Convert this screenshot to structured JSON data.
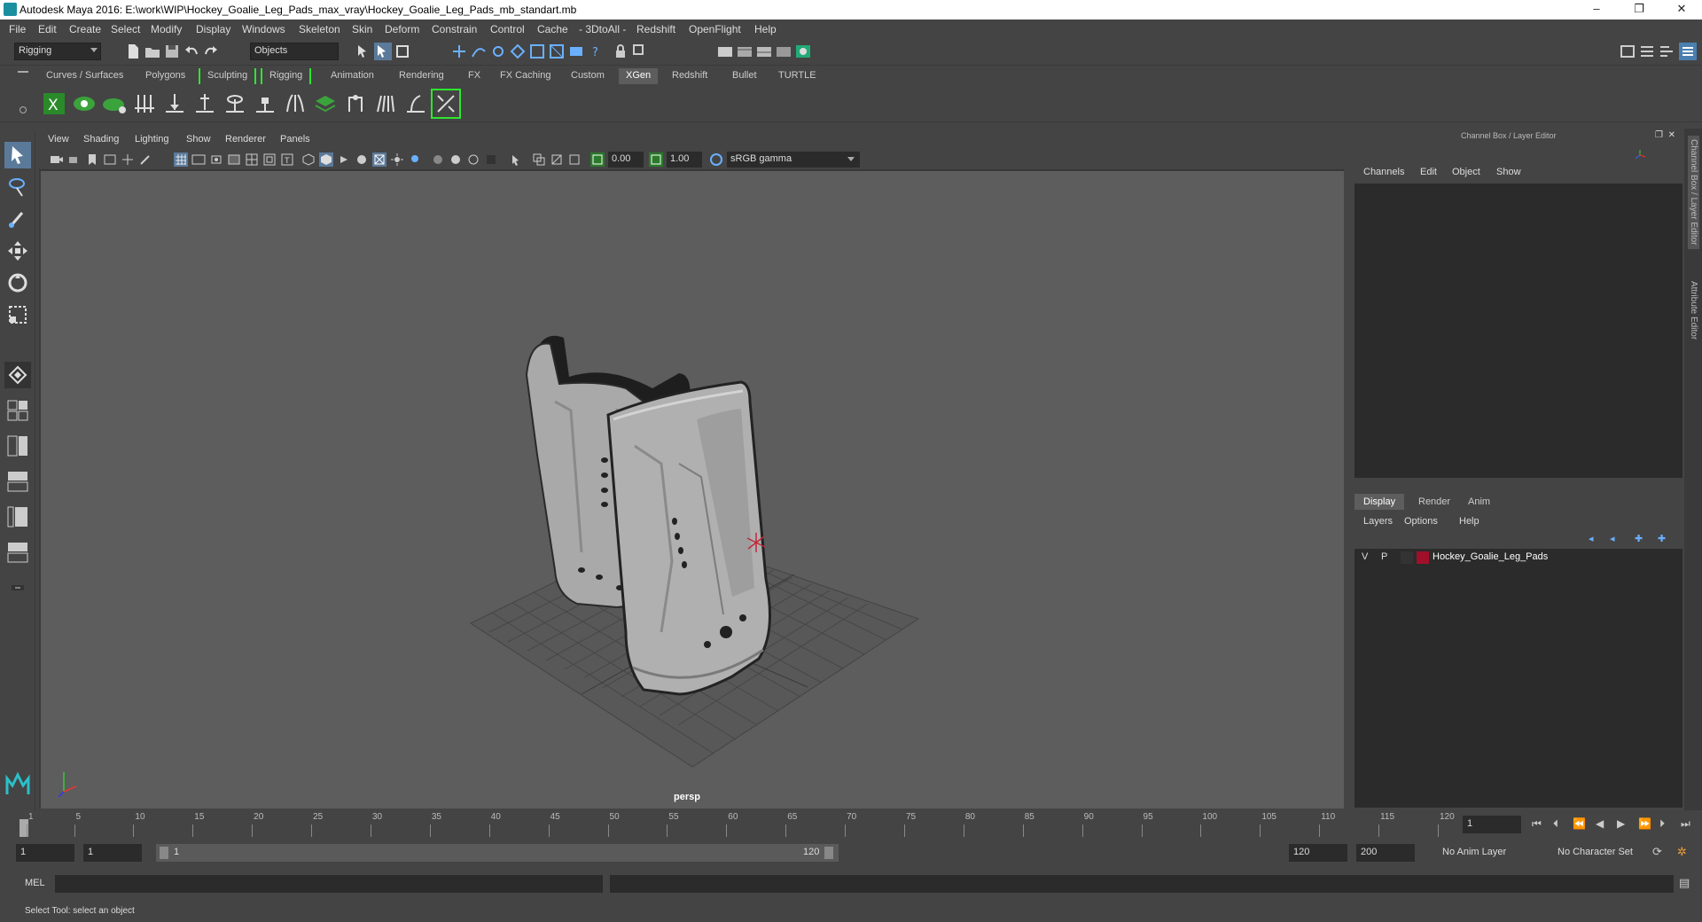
{
  "window": {
    "title": "Autodesk Maya 2016: E:\\work\\WIP\\Hockey_Goalie_Leg_Pads_max_vray\\Hockey_Goalie_Leg_Pads_mb_standart.mb",
    "minimize": "–",
    "restore": "❐",
    "close": "✕"
  },
  "menu": [
    "File",
    "Edit",
    "Create",
    "Select",
    "Modify",
    "Display",
    "Windows",
    "Skeleton",
    "Skin",
    "Deform",
    "Constrain",
    "Control",
    "Cache",
    "- 3DtoAll -",
    "Redshift",
    "OpenFlight",
    "Help"
  ],
  "status_line": {
    "menuset": "Rigging",
    "selection_mode": "Objects"
  },
  "shelf_tabs": [
    "Curves / Surfaces",
    "Polygons",
    "Sculpting",
    "Rigging",
    "Animation",
    "Rendering",
    "FX",
    "FX Caching",
    "Custom",
    "XGen",
    "Redshift",
    "Bullet",
    "TURTLE"
  ],
  "shelf_active": "XGen",
  "viewport": {
    "menu": [
      "View",
      "Shading",
      "Lighting",
      "Show",
      "Renderer",
      "Panels"
    ],
    "exposure": "0.00",
    "gamma": "1.00",
    "color_space": "sRGB gamma",
    "camera_label": "persp"
  },
  "channel_box": {
    "header": "Channel Box / Layer Editor",
    "menu": [
      "Channels",
      "Edit",
      "Object",
      "Show"
    ]
  },
  "layer_editor": {
    "tabs": [
      "Display",
      "Render",
      "Anim"
    ],
    "active_tab": "Display",
    "menu": [
      "Layers",
      "Options",
      "Help"
    ],
    "layers": [
      {
        "v": "V",
        "p": "P",
        "name": "Hockey_Goalie_Leg_Pads",
        "color": "#a0102a"
      }
    ]
  },
  "side_tabs": [
    "Channel Box / Layer Editor",
    "Attribute Editor"
  ],
  "timeline": {
    "ticks": [
      "1",
      "5",
      "10",
      "15",
      "20",
      "25",
      "30",
      "35",
      "40",
      "45",
      "50",
      "55",
      "60",
      "65",
      "70",
      "75",
      "80",
      "85",
      "90",
      "95",
      "100",
      "105",
      "110",
      "115",
      "120"
    ],
    "current_frame": "1"
  },
  "range": {
    "start": "1",
    "playback_start": "1",
    "slider_start": "1",
    "slider_end": "120",
    "playback_end": "120",
    "end": "200",
    "anim_layer": "No Anim Layer",
    "character_set": "No Character Set"
  },
  "command_line": {
    "label": "MEL"
  },
  "help_line": "Select Tool: select an object"
}
